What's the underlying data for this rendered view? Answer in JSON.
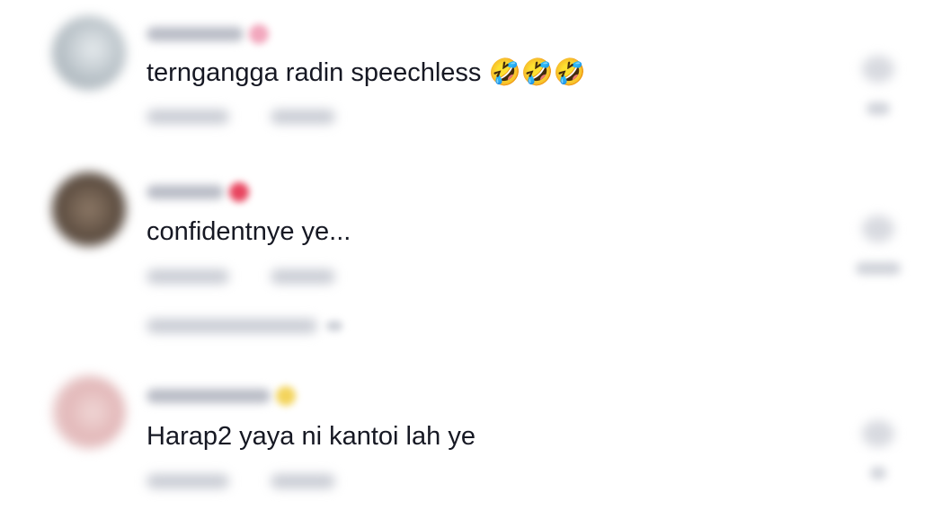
{
  "comments": [
    {
      "text": "terngangga radin speechless",
      "emoji": "🤣🤣🤣",
      "avatar_color": "#b7c0c6",
      "badge_color": "#f2a7bd",
      "has_view_replies": false
    },
    {
      "text": "confidentnye ye...",
      "emoji": "",
      "avatar_color": "#6b5a4a",
      "badge_color": "#e8455f",
      "has_view_replies": true
    },
    {
      "text": "Harap2 yaya ni kantoi lah ye",
      "emoji": "",
      "avatar_color": "#e9c4c6",
      "badge_color": "#f3d45c",
      "has_view_replies": false
    }
  ]
}
